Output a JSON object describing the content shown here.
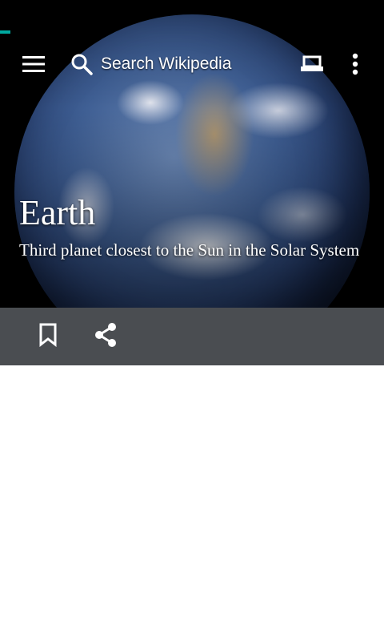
{
  "toolbar": {
    "menu_icon": "menu-icon",
    "search_icon": "search-icon",
    "search_placeholder": "Search Wikipedia",
    "reading_mode_icon": "reading-mode-icon",
    "overflow_icon": "more-vert-icon"
  },
  "article": {
    "title": "Earth",
    "description": "Third planet closest to the Sun in the Solar System"
  },
  "actions": {
    "bookmark_icon": "bookmark-icon",
    "share_icon": "share-icon"
  },
  "colors": {
    "accent": "#00a9a0",
    "action_bar": "#4a4d51",
    "text_on_image": "#ffffff"
  }
}
